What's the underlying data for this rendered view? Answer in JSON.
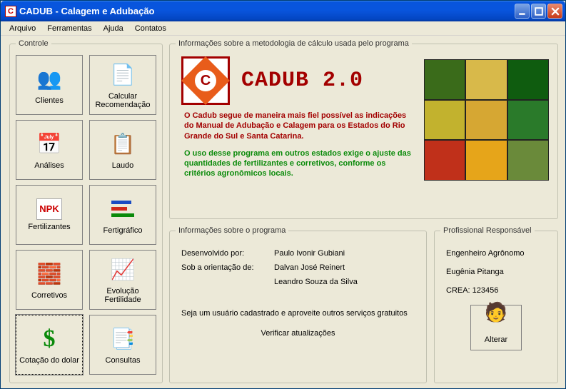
{
  "window": {
    "title": "CADUB - Calagem e Adubação",
    "app_icon_letter": "C"
  },
  "menu": {
    "items": [
      "Arquivo",
      "Ferramentas",
      "Ajuda",
      "Contatos"
    ]
  },
  "controle": {
    "legend": "Controle",
    "buttons": [
      {
        "name": "clientes-button",
        "label": "Clientes",
        "icon": "👥"
      },
      {
        "name": "calcular-recomendacao-button",
        "label": "Calcular Recomendação",
        "icon": "📄"
      },
      {
        "name": "analises-button",
        "label": "Análises",
        "icon": "📅"
      },
      {
        "name": "laudo-button",
        "label": "Laudo",
        "icon": "📋"
      },
      {
        "name": "fertilizantes-button",
        "label": "Fertilizantes",
        "icon": "NPK"
      },
      {
        "name": "fertigrafico-button",
        "label": "Fertigráfico",
        "icon": "≡"
      },
      {
        "name": "corretivos-button",
        "label": "Corretivos",
        "icon": "🧱"
      },
      {
        "name": "evolucao-fertilidade-button",
        "label": "Evolução Fertilidade",
        "icon": "📈"
      },
      {
        "name": "cotacao-dolar-button",
        "label": "Cotação do dolar",
        "icon": "$",
        "selected": true
      },
      {
        "name": "consultas-button",
        "label": "Consultas",
        "icon": "📑"
      }
    ]
  },
  "metodologia": {
    "legend": "Informações sobre a metodologia de cálculo usada pelo programa",
    "brand": "CADUB 2.0",
    "logo_letter": "C",
    "p1": "O Cadub segue de maneira mais fiel possível as indicações do Manual de Adubação e Calagem para os Estados do Rio Grande do Sul e Santa Catarina.",
    "p2": "O uso desse programa em outros estados exige o ajuste das quantidades de fertilizantes e corretivos, conforme os critérios agronômicos locais.",
    "photo_colors": [
      "#3a6b1a",
      "#d8b94a",
      "#0f5c0f",
      "#c2b22e",
      "#d6a733",
      "#2a7a2a",
      "#c0301a",
      "#e6a51a",
      "#6a8a3a"
    ]
  },
  "programa": {
    "legend": "Informações sobre o programa",
    "dev_label": "Desenvolvido por:",
    "dev_value": "Paulo Ivonir Gubiani",
    "orient_label": "Sob a orientação de:",
    "orient_value1": "Dalvan José Reinert",
    "orient_value2": "Leandro Souza da Silva",
    "footer": "Seja um usuário cadastrado e aproveite outros serviços gratuitos",
    "update_link": "Verificar atualizações"
  },
  "profissional": {
    "legend": "Profissional Responsável",
    "role": "Engenheiro Agrônomo",
    "name": "Eugênia Pitanga",
    "crea": "CREA: 123456",
    "alterar_label": "Alterar",
    "alterar_icon": "🧑"
  }
}
